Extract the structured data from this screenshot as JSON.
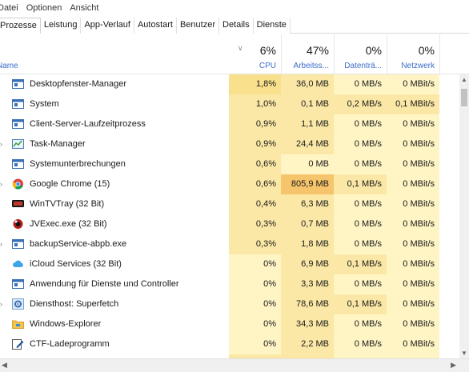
{
  "menu": [
    "Datei",
    "Optionen",
    "Ansicht"
  ],
  "tabs": [
    {
      "label": "Prozesse",
      "active": true
    },
    {
      "label": "Leistung"
    },
    {
      "label": "App-Verlauf"
    },
    {
      "label": "Autostart"
    },
    {
      "label": "Benutzer"
    },
    {
      "label": "Details"
    },
    {
      "label": "Dienste"
    }
  ],
  "header": {
    "name_label": "Name",
    "cpu": {
      "pct": "6%",
      "label": "CPU"
    },
    "mem": {
      "pct": "47%",
      "label": "Arbeitss..."
    },
    "disk": {
      "pct": "0%",
      "label": "Datenträ..."
    },
    "net": {
      "pct": "0%",
      "label": "Netzwerk"
    }
  },
  "colors": {
    "light": "#fff4c4",
    "mid": "#fbe8a6",
    "strong": "#f9e08c",
    "hot": "#f6c46a",
    "header_blue": "#3a6cc8"
  },
  "processes": [
    {
      "name": "Desktopfenster-Manager",
      "icon": "window-icon",
      "expand": false,
      "cpu": "1,8%",
      "mem": "36,0 MB",
      "disk": "0 MB/s",
      "net": "0 MBit/s"
    },
    {
      "name": "System",
      "icon": "window-icon",
      "expand": false,
      "cpu": "1,0%",
      "mem": "0,1 MB",
      "disk": "0,2 MB/s",
      "net": "0,1 MBit/s"
    },
    {
      "name": "Client-Server-Laufzeitprozess",
      "icon": "window-icon",
      "expand": false,
      "cpu": "0,9%",
      "mem": "1,1 MB",
      "disk": "0 MB/s",
      "net": "0 MBit/s"
    },
    {
      "name": "Task-Manager",
      "icon": "task-manager-icon",
      "expand": true,
      "cpu": "0,9%",
      "mem": "24,4 MB",
      "disk": "0 MB/s",
      "net": "0 MBit/s"
    },
    {
      "name": "Systemunterbrechungen",
      "icon": "window-icon",
      "expand": false,
      "cpu": "0,6%",
      "mem": "0 MB",
      "disk": "0 MB/s",
      "net": "0 MBit/s"
    },
    {
      "name": "Google Chrome (15)",
      "icon": "chrome-icon",
      "expand": true,
      "cpu": "0,6%",
      "mem": "805,9 MB",
      "disk": "0,1 MB/s",
      "net": "0 MBit/s"
    },
    {
      "name": "WinTVTray (32 Bit)",
      "icon": "tv-icon",
      "expand": false,
      "cpu": "0,4%",
      "mem": "6,3 MB",
      "disk": "0 MB/s",
      "net": "0 MBit/s"
    },
    {
      "name": "JVExec.exe (32 Bit)",
      "icon": "jv-icon",
      "expand": false,
      "cpu": "0,3%",
      "mem": "0,7 MB",
      "disk": "0 MB/s",
      "net": "0 MBit/s"
    },
    {
      "name": "backupService-abpb.exe",
      "icon": "window-icon",
      "expand": true,
      "cpu": "0,3%",
      "mem": "1,8 MB",
      "disk": "0 MB/s",
      "net": "0 MBit/s"
    },
    {
      "name": "iCloud Services (32 Bit)",
      "icon": "cloud-icon",
      "expand": false,
      "cpu": "0%",
      "mem": "6,9 MB",
      "disk": "0,1 MB/s",
      "net": "0 MBit/s"
    },
    {
      "name": "Anwendung für Dienste und Controller",
      "icon": "window-icon",
      "expand": false,
      "cpu": "0%",
      "mem": "3,3 MB",
      "disk": "0 MB/s",
      "net": "0 MBit/s"
    },
    {
      "name": "Diensthost: Superfetch",
      "icon": "gear-icon",
      "expand": true,
      "cpu": "0%",
      "mem": "78,6 MB",
      "disk": "0,1 MB/s",
      "net": "0 MBit/s"
    },
    {
      "name": "Windows-Explorer",
      "icon": "folder-icon",
      "expand": false,
      "cpu": "0%",
      "mem": "34,3 MB",
      "disk": "0 MB/s",
      "net": "0 MBit/s"
    },
    {
      "name": "CTF-Ladeprogramm",
      "icon": "pen-icon",
      "expand": false,
      "cpu": "0%",
      "mem": "2,2 MB",
      "disk": "0 MB/s",
      "net": "0 MBit/s"
    }
  ]
}
